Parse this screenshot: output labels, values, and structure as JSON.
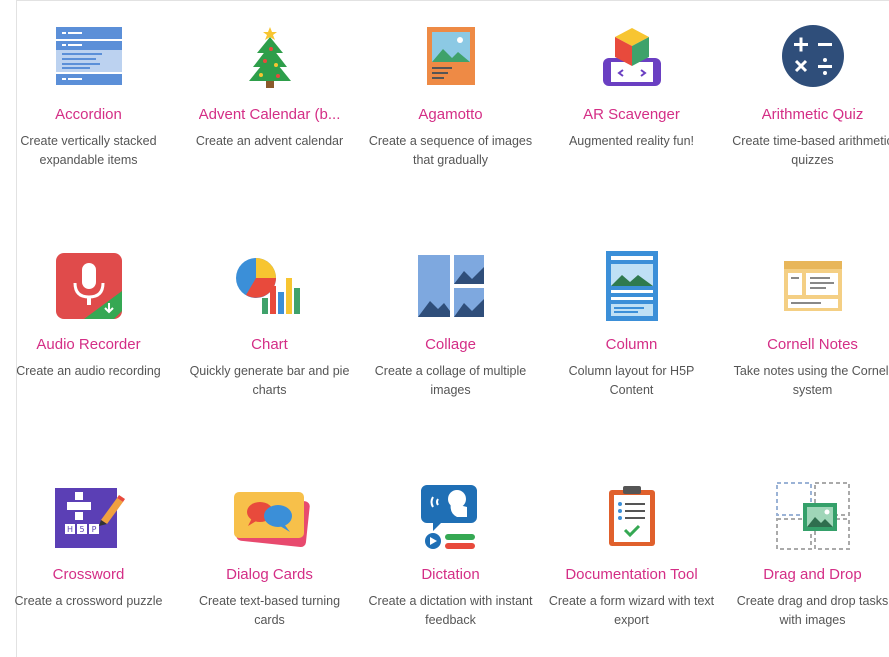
{
  "content_types": [
    {
      "title": "Accordion",
      "description": "Create vertically stacked expandable items",
      "icon": "accordion-icon"
    },
    {
      "title": "Advent Calendar (b...",
      "description": "Create an advent calendar",
      "icon": "christmas-tree-icon"
    },
    {
      "title": "Agamotto",
      "description": "Create a sequence of images that gradually",
      "icon": "image-sequence-icon"
    },
    {
      "title": "AR Scavenger",
      "description": "Augmented reality fun!",
      "icon": "ar-cube-icon"
    },
    {
      "title": "Arithmetic Quiz",
      "description": "Create time-based arithmetic quizzes",
      "icon": "arithmetic-icon"
    },
    {
      "title": "Audio Recorder",
      "description": "Create an audio recording",
      "icon": "microphone-icon"
    },
    {
      "title": "Chart",
      "description": "Quickly generate bar and pie charts",
      "icon": "chart-icon"
    },
    {
      "title": "Collage",
      "description": "Create a collage of multiple images",
      "icon": "collage-icon"
    },
    {
      "title": "Column",
      "description": "Column layout for H5P Content",
      "icon": "column-icon"
    },
    {
      "title": "Cornell Notes",
      "description": "Take notes using the Cornell system",
      "icon": "notes-icon"
    },
    {
      "title": "Crossword",
      "description": "Create a crossword puzzle",
      "icon": "crossword-icon"
    },
    {
      "title": "Dialog Cards",
      "description": "Create text-based turning cards",
      "icon": "dialog-cards-icon"
    },
    {
      "title": "Dictation",
      "description": "Create a dictation with instant feedback",
      "icon": "dictation-icon"
    },
    {
      "title": "Documentation Tool",
      "description": "Create a form wizard with text export",
      "icon": "clipboard-icon"
    },
    {
      "title": "Drag and Drop",
      "description": "Create drag and drop tasks with images",
      "icon": "drag-drop-icon"
    }
  ],
  "colors": {
    "title": "#d42e86",
    "description": "#555555"
  }
}
